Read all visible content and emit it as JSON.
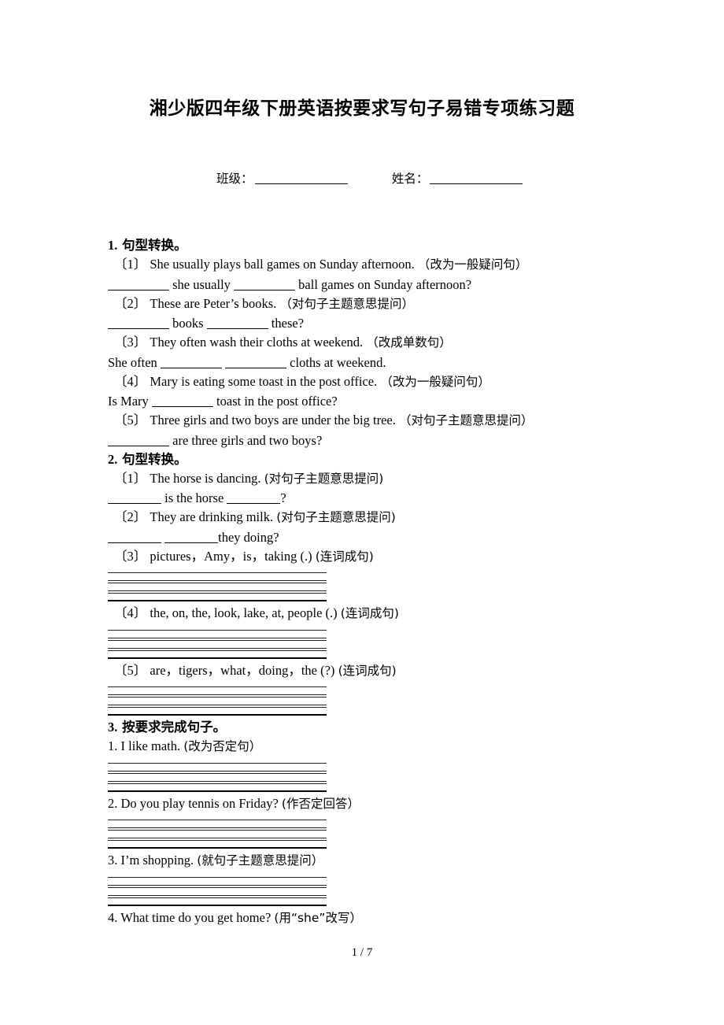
{
  "document": {
    "title": "湘少版四年级下册英语按要求写句子易错专项练习题",
    "footer": "1 / 7"
  },
  "id_fields": {
    "class_label": "班级：",
    "name_label": "姓名："
  },
  "sections": [
    {
      "number": "1.",
      "heading": "句型转换。",
      "items": [
        {
          "marker": "〔1〕",
          "prompt": "She usually plays ball games on Sunday afternoon.",
          "instruction": "（改为一般疑问句）",
          "answer_before": "",
          "answer_mid": "she usually",
          "answer_after": "ball games on Sunday afternoon?"
        },
        {
          "marker": "〔2〕",
          "prompt": "These are Peter’s books.",
          "instruction": "（对句子主题意思提问）",
          "answer_before": "",
          "answer_mid": "books",
          "answer_after": "these?"
        },
        {
          "marker": "〔3〕",
          "prompt": "They often wash their cloths at weekend.",
          "instruction": "（改成单数句）",
          "answer_before": "She often",
          "answer_mid": "",
          "answer_after": "cloths at weekend."
        },
        {
          "marker": "〔4〕",
          "prompt": "Mary is eating some toast in the post office.",
          "instruction": "（改为一般疑问句）",
          "answer_before": "Is Mary",
          "answer_mid": "",
          "answer_after": "toast in the post office?"
        },
        {
          "marker": "〔5〕",
          "prompt": "Three girls and two boys are under the big tree.",
          "instruction": "（对句子主题意思提问）",
          "answer_before": "",
          "answer_mid": "",
          "answer_after": "are three girls and two boys?"
        }
      ]
    },
    {
      "number": "2.",
      "heading": "句型转换。",
      "items": [
        {
          "marker": "〔1〕",
          "prompt": "The horse is dancing.",
          "instruction": "(对句子主题意思提问)",
          "answer_before": "",
          "answer_mid": "is the horse",
          "answer_after": "?"
        },
        {
          "marker": "〔2〕",
          "prompt": "They are drinking milk.",
          "instruction": "(对句子主题意思提问)",
          "answer_before": "",
          "answer_mid": "",
          "answer_after": "they doing?"
        },
        {
          "marker": "〔3〕",
          "prompt": "pictures，Amy，is，taking (.)",
          "instruction": "(连词成句)",
          "blank_lines": true
        },
        {
          "marker": "〔4〕",
          "prompt": "the, on, the, look, lake, at, people (.)",
          "instruction": "(连词成句)",
          "blank_lines": true
        },
        {
          "marker": "〔5〕",
          "prompt": "are，tigers，what，doing，the (?)",
          "instruction": "(连词成句)",
          "blank_lines": true
        }
      ]
    },
    {
      "number": "3.",
      "heading": "按要求完成句子。",
      "items": [
        {
          "marker": "1.",
          "prompt": "I like math.",
          "instruction": "(改为否定句）",
          "blank_lines": true
        },
        {
          "marker": "2.",
          "prompt": "Do you play tennis on Friday?",
          "instruction": "(作否定回答）",
          "blank_lines": true
        },
        {
          "marker": "3.",
          "prompt": "I’m shopping.",
          "instruction": "(就句子主题意思提问）",
          "blank_lines": true
        },
        {
          "marker": "4.",
          "prompt": "What time do you get home?",
          "instruction": "(用“she”改写）",
          "blank_lines": false
        }
      ]
    }
  ]
}
